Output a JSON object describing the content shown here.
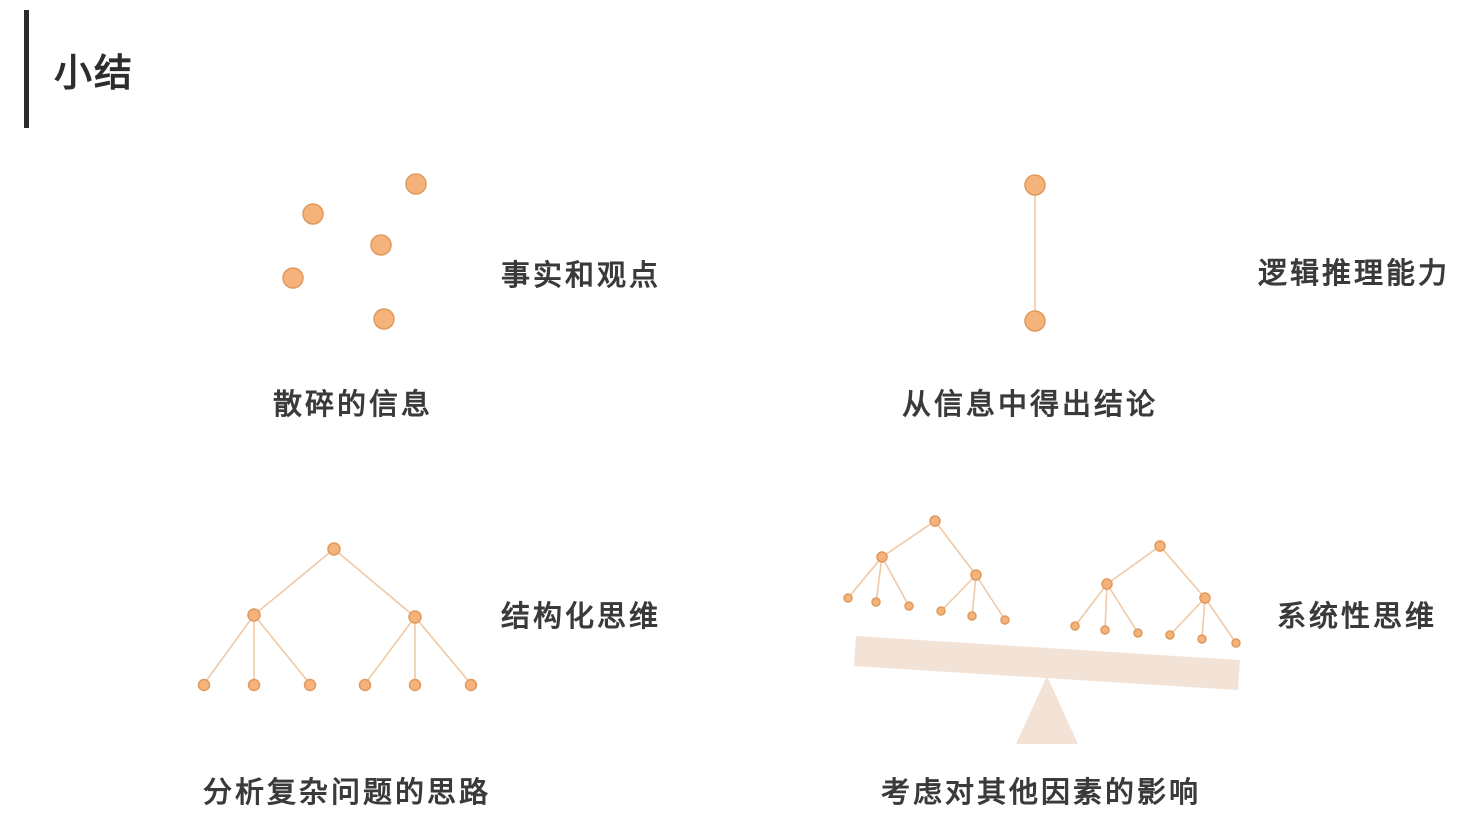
{
  "page": {
    "title": "小结",
    "watermark": ""
  },
  "colors": {
    "node": "#f5b27a",
    "node_stroke": "#e09a5d",
    "line": "#f0c9a6",
    "beam": "#f3e2d6",
    "text": "#3a3a3a"
  },
  "quadrants": [
    {
      "id": "scattered",
      "side_label": "事实和观点",
      "caption": "散碎的信息"
    },
    {
      "id": "logic",
      "side_label": "逻辑推理能力",
      "caption": "从信息中得出结论"
    },
    {
      "id": "structured",
      "side_label": "结构化思维",
      "caption": "分析复杂问题的思路"
    },
    {
      "id": "systemic",
      "side_label": "系统性思维",
      "caption": "考虑对其他因素的影响"
    }
  ]
}
